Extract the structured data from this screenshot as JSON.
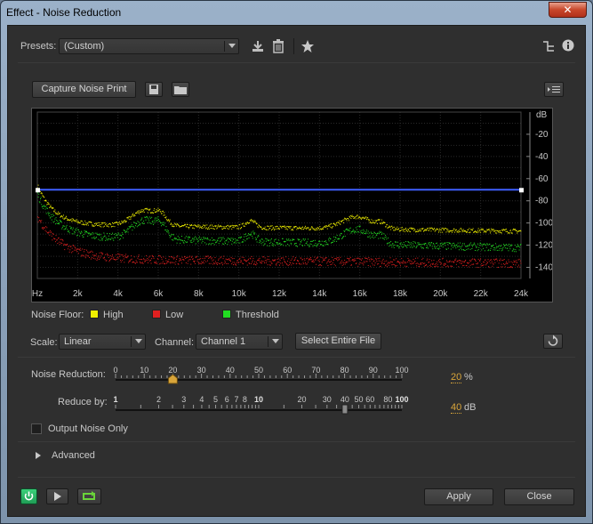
{
  "window": {
    "title": "Effect - Noise Reduction",
    "close_glyph": "✕"
  },
  "presets": {
    "label": "Presets:",
    "value": "(Custom)"
  },
  "capture_button": "Capture Noise Print",
  "graph": {
    "y_unit": "dB",
    "y_ticks": [
      "-20",
      "-40",
      "-60",
      "-80",
      "-100",
      "-120",
      "-140"
    ],
    "x_ticks": [
      "Hz",
      "2k",
      "4k",
      "6k",
      "8k",
      "10k",
      "12k",
      "14k",
      "16k",
      "18k",
      "20k",
      "22k",
      "24k"
    ],
    "threshold_db": -70,
    "colors": {
      "high": "#f0f000",
      "low": "#e02020",
      "threshold": "#22dd22",
      "line": "#3f5fff"
    }
  },
  "noise_floor": {
    "label": "Noise Floor:",
    "high": "High",
    "low": "Low",
    "threshold": "Threshold"
  },
  "scale": {
    "label": "Scale:",
    "value": "Linear"
  },
  "channel": {
    "label": "Channel:",
    "value": "Channel 1"
  },
  "select_file_button": "Select Entire File",
  "noise_reduction": {
    "label": "Noise Reduction:",
    "ticks": [
      "0",
      "10",
      "20",
      "30",
      "40",
      "50",
      "60",
      "70",
      "80",
      "90",
      "100"
    ],
    "value": "20",
    "unit": "%",
    "position_pct": 20
  },
  "reduce_by": {
    "label": "Reduce by:",
    "ticks": [
      "1",
      "2",
      "3",
      "4",
      "5",
      "6",
      "7",
      "8",
      "10",
      "20",
      "30",
      "40",
      "50",
      "60",
      "80",
      "100"
    ],
    "value": "40",
    "unit": "dB"
  },
  "output_noise_only": "Output Noise Only",
  "advanced": "Advanced",
  "apply_button": "Apply",
  "close_button": "Close"
}
